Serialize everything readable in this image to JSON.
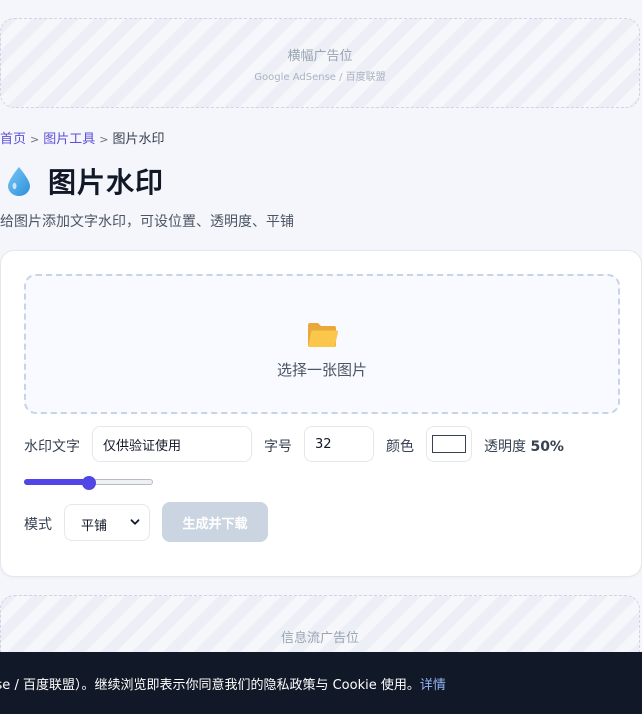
{
  "ads": {
    "top_title": "横幅广告位",
    "top_sub": "Google AdSense / 百度联盟",
    "mid_title": "信息流广告位"
  },
  "breadcrumb": {
    "home": "首页",
    "sep": ">",
    "section": "图片工具",
    "current": "图片水印"
  },
  "header": {
    "icon": "water-drop-icon",
    "title": "图片水印",
    "subtitle": "给图片添加文字水印，可设位置、透明度、平铺"
  },
  "uploader": {
    "icon": "folder-icon",
    "label": "选择一张图片"
  },
  "form": {
    "text_label": "水印文字",
    "text_value": "仅供验证使用",
    "size_label": "字号",
    "size_value": "32",
    "color_label": "颜色",
    "color_value": "#ffffff",
    "opacity_label": "透明度",
    "opacity_text": "50%",
    "opacity_value": 0.5,
    "mode_label": "模式",
    "mode_value": "平铺",
    "generate_button": "生成并下载"
  },
  "cookie": {
    "text": "e AdSense / 百度联盟）。继续浏览即表示你同意我们的隐私政策与 Cookie 使用。",
    "link": "详情"
  },
  "colors": {
    "accent": "#4f46e5",
    "link": "#5b4fd6",
    "button_disabled": "#cbd5e1",
    "cookie_bg": "#111827"
  }
}
